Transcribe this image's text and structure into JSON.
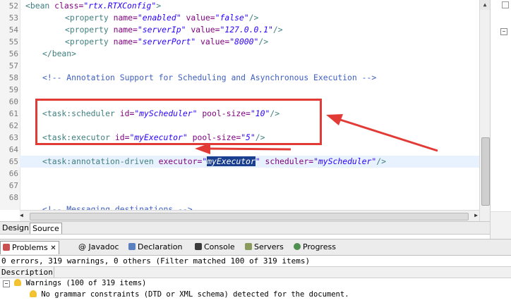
{
  "editor": {
    "lines": [
      {
        "num": "52"
      },
      {
        "num": "53"
      },
      {
        "num": "54"
      },
      {
        "num": "55"
      },
      {
        "num": "56"
      },
      {
        "num": "57"
      },
      {
        "num": "58"
      },
      {
        "num": "59"
      },
      {
        "num": "60"
      },
      {
        "num": "61"
      },
      {
        "num": "62"
      },
      {
        "num": "63"
      },
      {
        "num": "64"
      },
      {
        "num": "65"
      },
      {
        "num": "66"
      },
      {
        "num": "67"
      },
      {
        "num": "68"
      }
    ],
    "code": {
      "l52_tag": "<bean",
      "l52_attr": "class=",
      "l52_val": "\"rtx.RTXConfig\"",
      "l52_end": ">",
      "l53_tag": "<property",
      "l53_a1": "name=",
      "l53_v1": "\"enabled\"",
      "l53_a2": "value=",
      "l53_v2": "\"false\"",
      "l53_end": "/>",
      "l54_tag": "<property",
      "l54_a1": "name=",
      "l54_v1": "\"serverIp\"",
      "l54_a2": "value=",
      "l54_v2": "\"127.0.0.1\"",
      "l54_end": "/>",
      "l55_tag": "<property",
      "l55_a1": "name=",
      "l55_v1": "\"serverPort\"",
      "l55_a2": "value=",
      "l55_v2": "\"8000\"",
      "l55_end": "/>",
      "l56": "</bean>",
      "l58": "<!-- Annotation Support for Scheduling and Asynchronous Execution -->",
      "l61_tag": "<task:scheduler",
      "l61_a1": "id=",
      "l61_v1": "\"myScheduler\"",
      "l61_a2": "pool-size=",
      "l61_v2": "\"10\"",
      "l61_end": "/>",
      "l63_tag": "<task:executor",
      "l63_a1": "id=",
      "l63_v1": "\"myExecutor\"",
      "l63_a2": "pool-size=",
      "l63_v2": "\"5\"",
      "l63_end": "/>",
      "l65_tag": "<task:annotation-driven",
      "l65_a1": "executor=",
      "l65_q1": "\"",
      "l65_sel": "myExecutor",
      "l65_q2": "\"",
      "l65_a2": "scheduler=",
      "l65_v2": "\"myScheduler\"",
      "l65_end": "/>",
      "l68": "<!-- Messaging destinations -->"
    }
  },
  "editor_tabs": {
    "design": "Design",
    "source": "Source"
  },
  "panel_tabs": [
    {
      "label": "Problems",
      "close": "✕"
    },
    {
      "label": "@ Javadoc"
    },
    {
      "label": "Declaration"
    },
    {
      "label": "Console"
    },
    {
      "label": "Servers"
    },
    {
      "label": "Progress"
    }
  ],
  "problems": {
    "summary": "0 errors, 319 warnings, 0 others (Filter matched 100 of 319 items)",
    "column_header": "Description",
    "group": "Warnings (100 of 319 items)",
    "item": "No grammar constraints (DTD or XML schema) detected for the document."
  },
  "colors": {
    "annotation_red": "#e23b36",
    "selection": "#1b3f8f",
    "tag": "#3f7f7f",
    "attr": "#7f007f",
    "value": "#2a00ff",
    "comment": "#3f5fbf"
  },
  "icons": {
    "problems": "problems-icon",
    "declaration": "declaration-icon",
    "console": "console-icon",
    "servers": "servers-icon",
    "progress": "progress-icon",
    "warning": "warning-icon"
  }
}
